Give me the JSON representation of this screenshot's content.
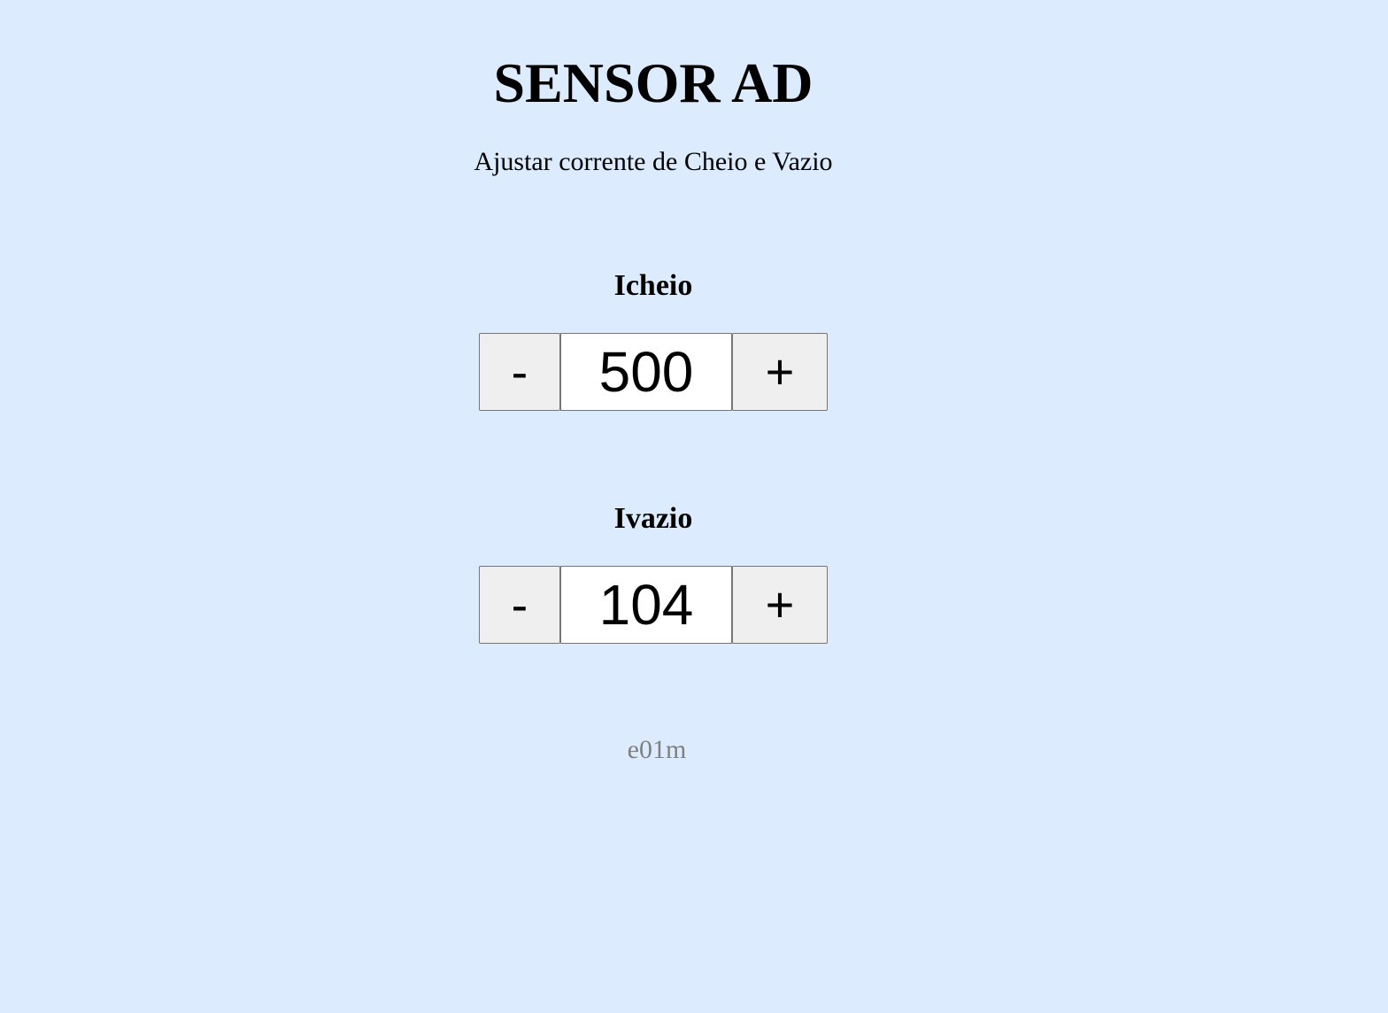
{
  "header": {
    "title": "SENSOR AD",
    "subtitle": "Ajustar corrente de Cheio e Vazio"
  },
  "controls": [
    {
      "label": "Icheio",
      "value": "500",
      "decrement_label": "-",
      "increment_label": "+"
    },
    {
      "label": "Ivazio",
      "value": "104",
      "decrement_label": "-",
      "increment_label": "+"
    }
  ],
  "footer": {
    "text": "e01m"
  },
  "colors": {
    "background": "#dcecfe",
    "button": "#efefef",
    "input": "#ffffff",
    "border": "#767676",
    "footer_text": "#808080"
  }
}
